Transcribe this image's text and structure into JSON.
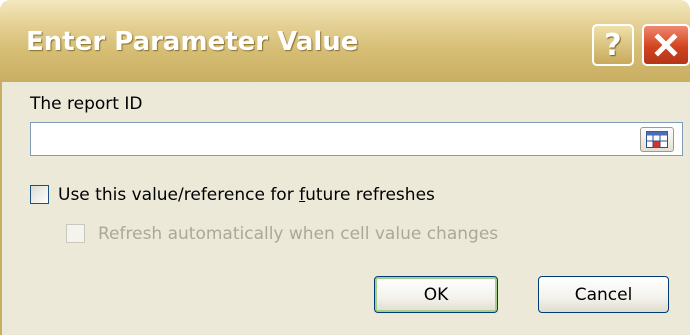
{
  "dialog": {
    "title": "Enter Parameter Value",
    "help_glyph": "?",
    "close_icon": "close-icon"
  },
  "form": {
    "label": "The report ID",
    "input_value": "",
    "range_icon": "range-selector-icon"
  },
  "options": {
    "future_refresh": {
      "label_before": "Use this value/reference for ",
      "label_accel": "f",
      "label_after": "uture refreshes",
      "checked": false
    },
    "auto_refresh": {
      "label": "Refresh automatically when cell value changes",
      "checked": false,
      "enabled": false
    }
  },
  "buttons": {
    "ok": "OK",
    "cancel": "Cancel"
  },
  "colors": {
    "titlebar": "#D6BE75",
    "close": "#D1441F",
    "face": "#ECE9D8"
  }
}
